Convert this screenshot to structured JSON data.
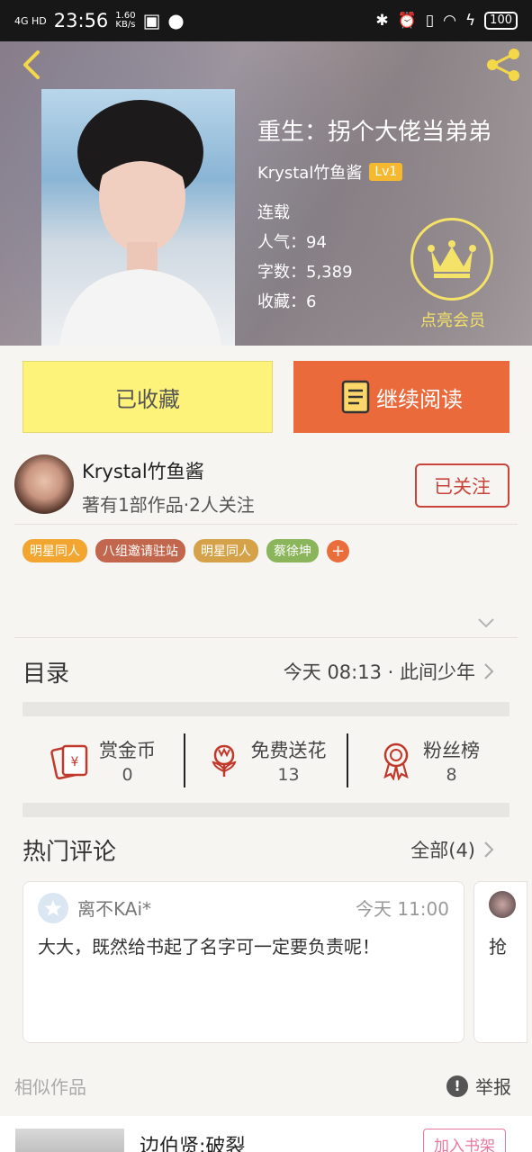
{
  "status_bar": {
    "network": "4G HD",
    "time": "23:56",
    "speed": "1.60\nKB/s",
    "battery": "100"
  },
  "book": {
    "title": "重生：拐个大佬当弟弟",
    "author": "Krystal竹鱼酱",
    "level": "Lv1",
    "status": "连载",
    "popularity": "人气：94",
    "word_count": "字数：5,389",
    "collections": "收藏：6",
    "vip_label": "点亮会员"
  },
  "actions": {
    "collected_label": "已收藏",
    "continue_label": "继续阅读"
  },
  "author_info": {
    "name": "Krystal竹鱼酱",
    "subtitle": "著有1部作品·2人关注",
    "follow_label": "已关注"
  },
  "tags": [
    {
      "label": "明星同人",
      "color": "#f2a62f"
    },
    {
      "label": "八组邀请驻站",
      "color": "#c2674d"
    },
    {
      "label": "明星同人",
      "color": "#d5a24a"
    },
    {
      "label": "蔡徐坤",
      "color": "#8bb55a"
    }
  ],
  "catalog": {
    "title": "目录",
    "latest": "今天 08:13 · 此间少年"
  },
  "stats": [
    {
      "label": "赏金币",
      "value": "0",
      "icon": "red-envelope-icon"
    },
    {
      "label": "免费送花",
      "value": "13",
      "icon": "flower-icon"
    },
    {
      "label": "粉丝榜",
      "value": "8",
      "icon": "medal-icon"
    }
  ],
  "comments": {
    "title": "热门评论",
    "all_label": "全部(4)",
    "items": [
      {
        "user": "离不KAi*",
        "time": "今天 11:00",
        "text": "大大，既然给书起了名字可一定要负责呢！"
      },
      {
        "text": "抢"
      }
    ]
  },
  "similar": {
    "title": "相似作品",
    "report_label": "举报",
    "item_title": "边伯贤:破裂",
    "add_shelf_label": "加入书架"
  },
  "colors": {
    "accent_orange": "#ea6a3c",
    "collected_yellow": "#fdf27a",
    "follow_red": "#c8443a",
    "vip_gold": "#f5e268"
  }
}
